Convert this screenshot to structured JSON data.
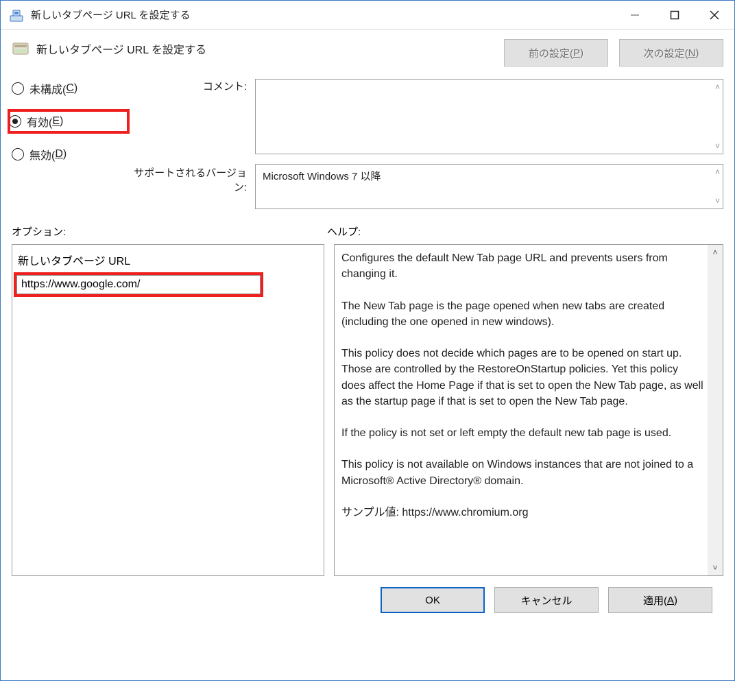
{
  "window": {
    "title": "新しいタブページ URL を設定する"
  },
  "header": {
    "page_title": "新しいタブページ URL を設定する",
    "prev_label_pre": "前の設定(",
    "prev_key": "P",
    "prev_label_post": ")",
    "next_label_pre": "次の設定(",
    "next_key": "N",
    "next_label_post": ")"
  },
  "radios": {
    "not_configured_pre": "未構成(",
    "not_configured_key": "C",
    "not_configured_post": ")",
    "enabled_pre": "有効(",
    "enabled_key": "E",
    "enabled_post": ")",
    "disabled_pre": "無効(",
    "disabled_key": "D",
    "disabled_post": ")",
    "selected": "enabled"
  },
  "labels": {
    "comment": "コメント:",
    "supported": "サポートされるバージョン:",
    "options": "オプション:",
    "help": "ヘルプ:"
  },
  "supported_text": "Microsoft Windows 7 以降",
  "options": {
    "field_label": "新しいタブページ URL",
    "url_value": "https://www.google.com/"
  },
  "help": {
    "p1": "Configures the default New Tab page URL and prevents users from changing it.",
    "p2": "The New Tab page is the page opened when new tabs are created (including the one opened in new windows).",
    "p3": "This policy does not decide which pages are to be opened on start up. Those are controlled by the RestoreOnStartup policies. Yet this policy does affect the Home Page if that is set to open the New Tab page, as well as the startup page if that is set to open the New Tab page.",
    "p4": "If the policy is not set or left empty the default new tab page is used.",
    "p5": "This policy is not available on Windows instances that are not joined to a Microsoft® Active Directory® domain.",
    "p6": "サンプル値: https://www.chromium.org"
  },
  "footer": {
    "ok": "OK",
    "cancel": "キャンセル",
    "apply_pre": "適用(",
    "apply_key": "A",
    "apply_post": ")"
  }
}
